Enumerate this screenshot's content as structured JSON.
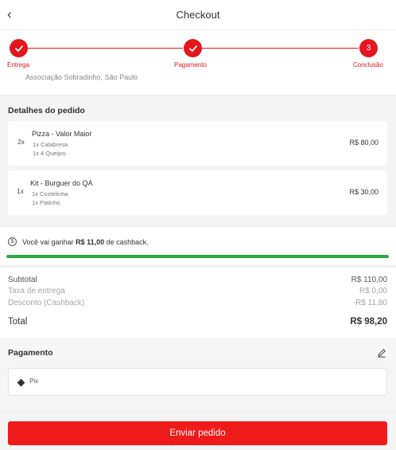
{
  "header": {
    "back_icon": "chevron-left-icon",
    "title": "Checkout"
  },
  "stepper": {
    "steps": [
      {
        "label": "Entrega",
        "state": "done"
      },
      {
        "label": "Pagamento",
        "state": "done"
      },
      {
        "label": "Conclusão",
        "state": "current",
        "number": "3"
      }
    ],
    "accent": "#e3171d"
  },
  "address": {
    "text": "Associação Sobradinho, São Paulo"
  },
  "order": {
    "title": "Detalhes do pedido",
    "items": [
      {
        "qty": "2x",
        "name": "Pizza - Valor Maior",
        "options": [
          "1x Calabresa",
          "1x 4 Queijos"
        ],
        "price": "R$ 80,00"
      },
      {
        "qty": "1x",
        "name": "Kit - Burguer do QA",
        "options": [
          "1x Costelinha",
          "1x Patinho"
        ],
        "price": "R$ 30,00"
      }
    ]
  },
  "cashback": {
    "prefix": "Você vai ganhar ",
    "amount": "R$ 11,00",
    "suffix": " de cashback.",
    "progress": 1.0,
    "color": "#2aa843"
  },
  "summary": {
    "subtotal_label": "Subtotal",
    "subtotal_value": "R$ 110,00",
    "delivery_label": "Taxa de entrega",
    "delivery_value": "R$ 0,00",
    "discount_label": "Desconto (Cashback)",
    "discount_value": "-R$ 11,80",
    "total_label": "Total",
    "total_value": "R$ 98,20"
  },
  "payment": {
    "title": "Pagamento",
    "method": "Pix",
    "edit_icon": "pencil-icon"
  },
  "submit": {
    "label": "Enviar pedido",
    "color": "#ef1a1a"
  }
}
